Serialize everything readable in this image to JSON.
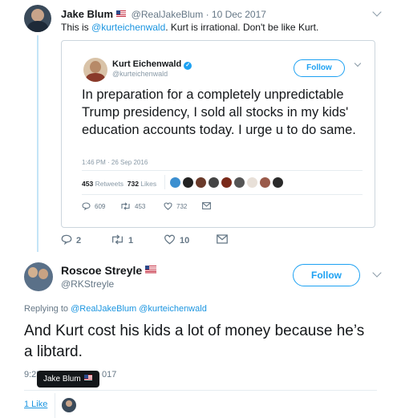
{
  "parent_tweet": {
    "author_name": "Jake Blum",
    "handle": "@RealJakeBlum",
    "date": "10 Dec 2017",
    "text_before": "This is ",
    "mention": "@kurteichenwald",
    "text_after": ". Kurt is irrational. Don't be like Kurt.",
    "replies": "2",
    "retweets": "1",
    "likes": "10"
  },
  "quoted_tweet": {
    "author_name": "Kurt Eichenwald",
    "handle": "@kurteichenwald",
    "follow_label": "Follow",
    "text": "In preparation for a completely unpredictable Trump presidency, I sold all stocks in my kids' education accounts today. I urge u to do same.",
    "timestamp": "1:46 PM · 26 Sep 2016",
    "retweets_count": "453",
    "retweets_label": "Retweets",
    "likes_count": "732",
    "likes_label": "Likes",
    "replies": "609",
    "retweets": "453",
    "likes": "732"
  },
  "reply_tweet": {
    "author_name": "Roscoe Streyle",
    "handle": "@RKStreyle",
    "follow_label": "Follow",
    "replying_prefix": "Replying to",
    "replying_to_1": "@RealJakeBlum",
    "replying_to_2": "@kurteichenwald",
    "text": "And Kurt cost his kids a lot of money because he’s a libtard.",
    "time_left_fragment": "9:25",
    "time_right_fragment": "017",
    "likes_text": "1 Like"
  },
  "tooltip": {
    "name": "Jake Blum"
  },
  "colors": {
    "accent": "#1da1f2",
    "link": "#1b95e0",
    "muted": "#657786",
    "thread_line": "#c4e4f7"
  }
}
